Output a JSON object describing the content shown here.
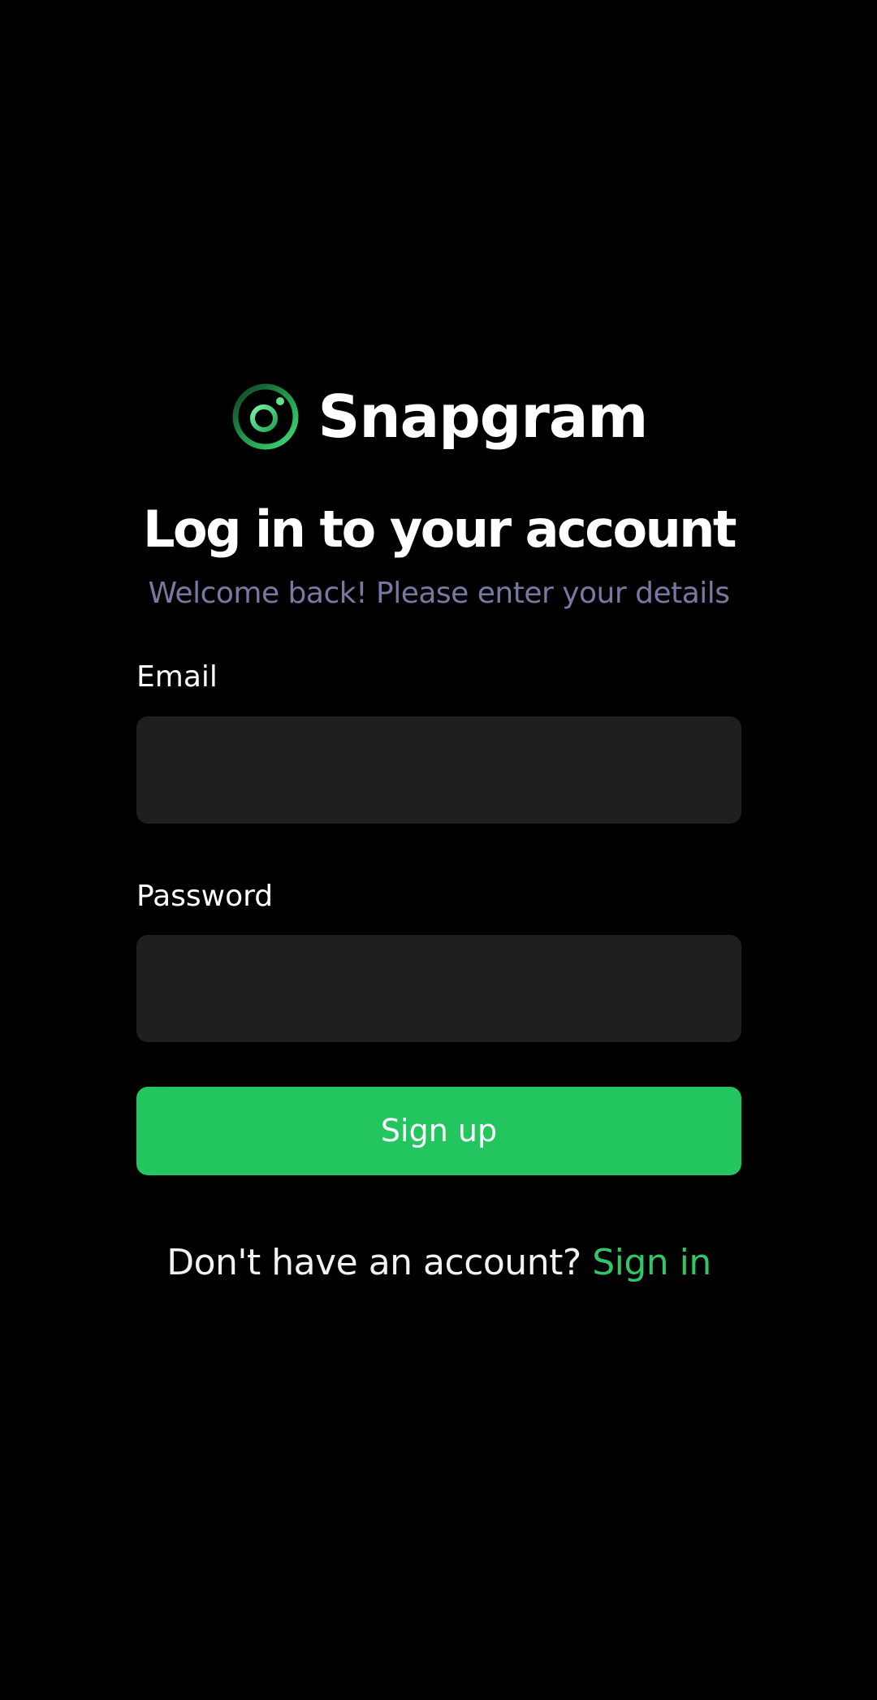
{
  "brand": {
    "name": "Snapgram",
    "logo_icon": "camera-ring-icon",
    "accent_color": "#22c55e"
  },
  "heading": {
    "title": "Log in to your account",
    "subtitle": "Welcome back! Please enter your details"
  },
  "form": {
    "email": {
      "label": "Email",
      "value": "",
      "placeholder": ""
    },
    "password": {
      "label": "Password",
      "value": "",
      "placeholder": ""
    },
    "submit_label": "Sign up"
  },
  "footer": {
    "prompt": "Don't have an account?",
    "link_label": "Sign in"
  },
  "colors": {
    "background": "#000000",
    "input_background": "#1f1f22",
    "subtitle": "#7878a3",
    "link": "#34c46a"
  }
}
